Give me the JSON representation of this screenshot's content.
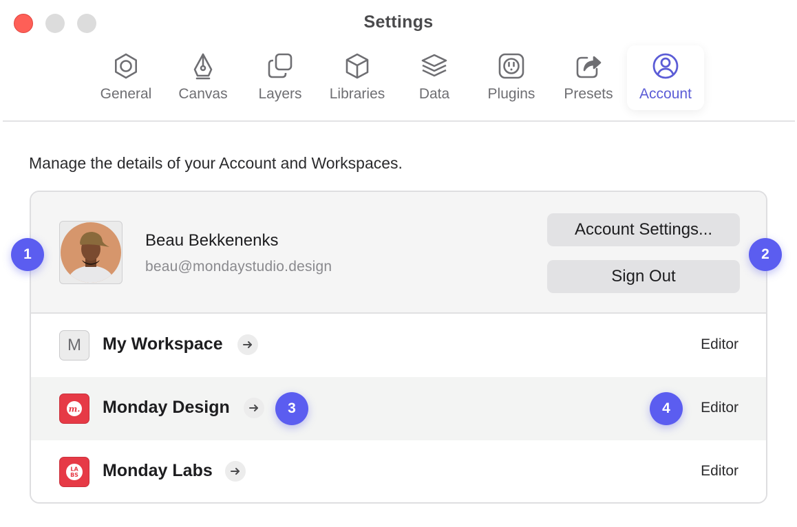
{
  "window": {
    "title": "Settings"
  },
  "toolbar": {
    "tabs": [
      {
        "label": "General",
        "icon": "hexagon-gear-icon"
      },
      {
        "label": "Canvas",
        "icon": "pen-nib-icon"
      },
      {
        "label": "Layers",
        "icon": "stacked-squares-icon"
      },
      {
        "label": "Libraries",
        "icon": "cube-icon"
      },
      {
        "label": "Data",
        "icon": "layers-stack-icon"
      },
      {
        "label": "Plugins",
        "icon": "plug-socket-icon"
      },
      {
        "label": "Presets",
        "icon": "share-export-icon"
      },
      {
        "label": "Account",
        "icon": "user-circle-icon",
        "active": true
      }
    ],
    "accent_color": "#5b5cd6"
  },
  "intro": "Manage the details of your Account and Workspaces.",
  "account": {
    "name": "Beau Bekkenenks",
    "email": "beau@mondaystudio.design",
    "settings_button": "Account Settings...",
    "signout_button": "Sign Out"
  },
  "workspaces": [
    {
      "name": "My Workspace",
      "icon_letter": "M",
      "role": "Editor"
    },
    {
      "name": "Monday Design",
      "icon_letter": "m.",
      "role": "Editor"
    },
    {
      "name": "Monday Labs",
      "icon_letter": "LABS",
      "role": "Editor"
    }
  ],
  "markers": [
    "1",
    "2",
    "3",
    "4"
  ],
  "colors": {
    "marker": "#5b5df0",
    "brand_red": "#e63a46",
    "close": "#fe5f57"
  }
}
